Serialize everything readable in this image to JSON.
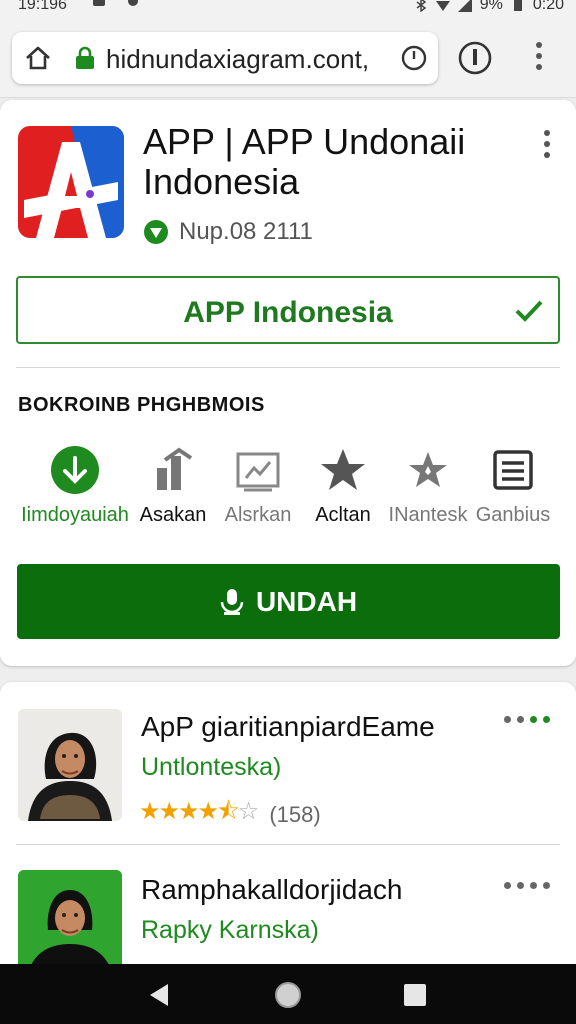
{
  "status_bar": {
    "time": "19:196",
    "battery": "9%",
    "clock_right": "0:20"
  },
  "browser": {
    "url": "hidnundaxiagram.cont,"
  },
  "app": {
    "title": "APP | APP Undonaii Indonesia",
    "meta": "Nup.08 2111",
    "outline_button_label": "APP Indonesia",
    "section_title": "BOKROINB PHGHBMOIS",
    "actions": [
      {
        "label": "Iimdoyauiah",
        "icon": "download-icon",
        "color": "#1f8a1f"
      },
      {
        "label": "Asakan",
        "icon": "trending-icon",
        "color": "#111111"
      },
      {
        "label": "Alsrkan",
        "icon": "chart-icon",
        "color": "#777777"
      },
      {
        "label": "Acltan",
        "icon": "star-icon",
        "color": "#111111"
      },
      {
        "label": "INantesk",
        "icon": "star-outline-icon",
        "color": "#777777"
      },
      {
        "label": "Ganbius",
        "icon": "list-icon",
        "color": "#777777"
      }
    ],
    "primary_button_label": "UNDAH"
  },
  "list": {
    "items": [
      {
        "title": "ApP giaritianpiardEame",
        "subtitle": "Untlonteska)",
        "rating_count": "(158)",
        "stars": 4.5
      },
      {
        "title": "Ramphakalldorjidach",
        "subtitle": "Rapky Karnska)"
      }
    ]
  },
  "colors": {
    "accent": "#0b6d0b",
    "accent_light": "#1f8a1f",
    "star": "#f2a100",
    "nav_bg": "#0a0a0a"
  }
}
